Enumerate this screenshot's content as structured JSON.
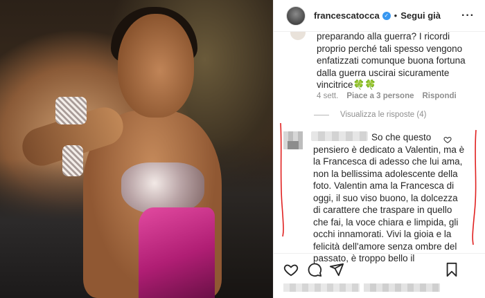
{
  "post": {
    "username": "francescatocca",
    "follow_label": "Segui già",
    "separator": "•"
  },
  "comments": {
    "first": {
      "text": "preparando alla guerra? I ricordi proprio perché tali spesso vengono enfatizzati comunque buona fortuna dalla guerra uscirai sicuramente vincitrice🍀🍀",
      "time": "4 sett.",
      "likes": "Piace a 3 persone",
      "reply_label": "Rispondi"
    },
    "replies_toggle": "Visualizza le risposte (4)",
    "second": {
      "text": "So che questo pensiero è dedicato a Valentin, ma è la Francesca di adesso che lui ama, non la bellissima adolescente della foto. Valentin ama la Francesca di oggi, il suo viso buono, la dolcezza di carattere che traspare in quello che fai, la voce chiara e limpida, gli occhi innamorati. Vivi la gioia e la felicità dell'amore senza ombre del passato, è troppo bello il"
    }
  },
  "icons": {
    "verified": "verified-badge-icon",
    "more": "more-options-icon",
    "like": "heart-icon",
    "comment": "comment-icon",
    "share": "share-icon",
    "save": "bookmark-icon"
  },
  "colors": {
    "verified": "#3897f0",
    "annotation": "#e0201f",
    "muted": "#8e8e8e"
  }
}
